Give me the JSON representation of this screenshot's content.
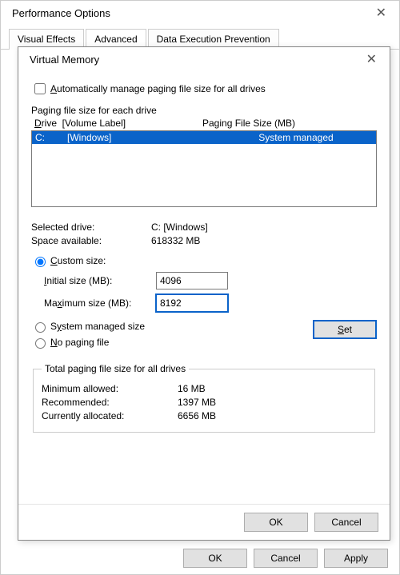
{
  "parent": {
    "title": "Performance Options",
    "tabs": [
      "Visual Effects",
      "Advanced",
      "Data Execution Prevention"
    ],
    "active_tab": 1,
    "buttons": {
      "ok": "OK",
      "cancel": "Cancel",
      "apply": "Apply"
    }
  },
  "modal": {
    "title": "Virtual Memory",
    "auto_manage_label": "Automatically manage paging file size for all drives",
    "auto_manage_checked": false,
    "paging_group_label": "Paging file size for each drive",
    "drive_header": {
      "col1": "Drive  [Volume Label]",
      "col2": "Paging File Size (MB)"
    },
    "drives": [
      {
        "letter": "C:",
        "label": "[Windows]",
        "size": "System managed",
        "selected": true
      }
    ],
    "selected_drive_label": "Selected drive:",
    "selected_drive_value": "C:  [Windows]",
    "space_available_label": "Space available:",
    "space_available_value": "618332 MB",
    "custom_size_label": "Custom size:",
    "custom_size_selected": true,
    "initial_size_label": "Initial size (MB):",
    "initial_size_value": "4096",
    "max_size_label": "Maximum size (MB):",
    "max_size_value": "8192",
    "system_managed_label": "System managed size",
    "no_paging_label": "No paging file",
    "set_button": "Set",
    "total_group_label": "Total paging file size for all drives",
    "min_allowed_label": "Minimum allowed:",
    "min_allowed_value": "16 MB",
    "recommended_label": "Recommended:",
    "recommended_value": "1397 MB",
    "current_label": "Currently allocated:",
    "current_value": "6656 MB",
    "buttons": {
      "ok": "OK",
      "cancel": "Cancel"
    }
  }
}
